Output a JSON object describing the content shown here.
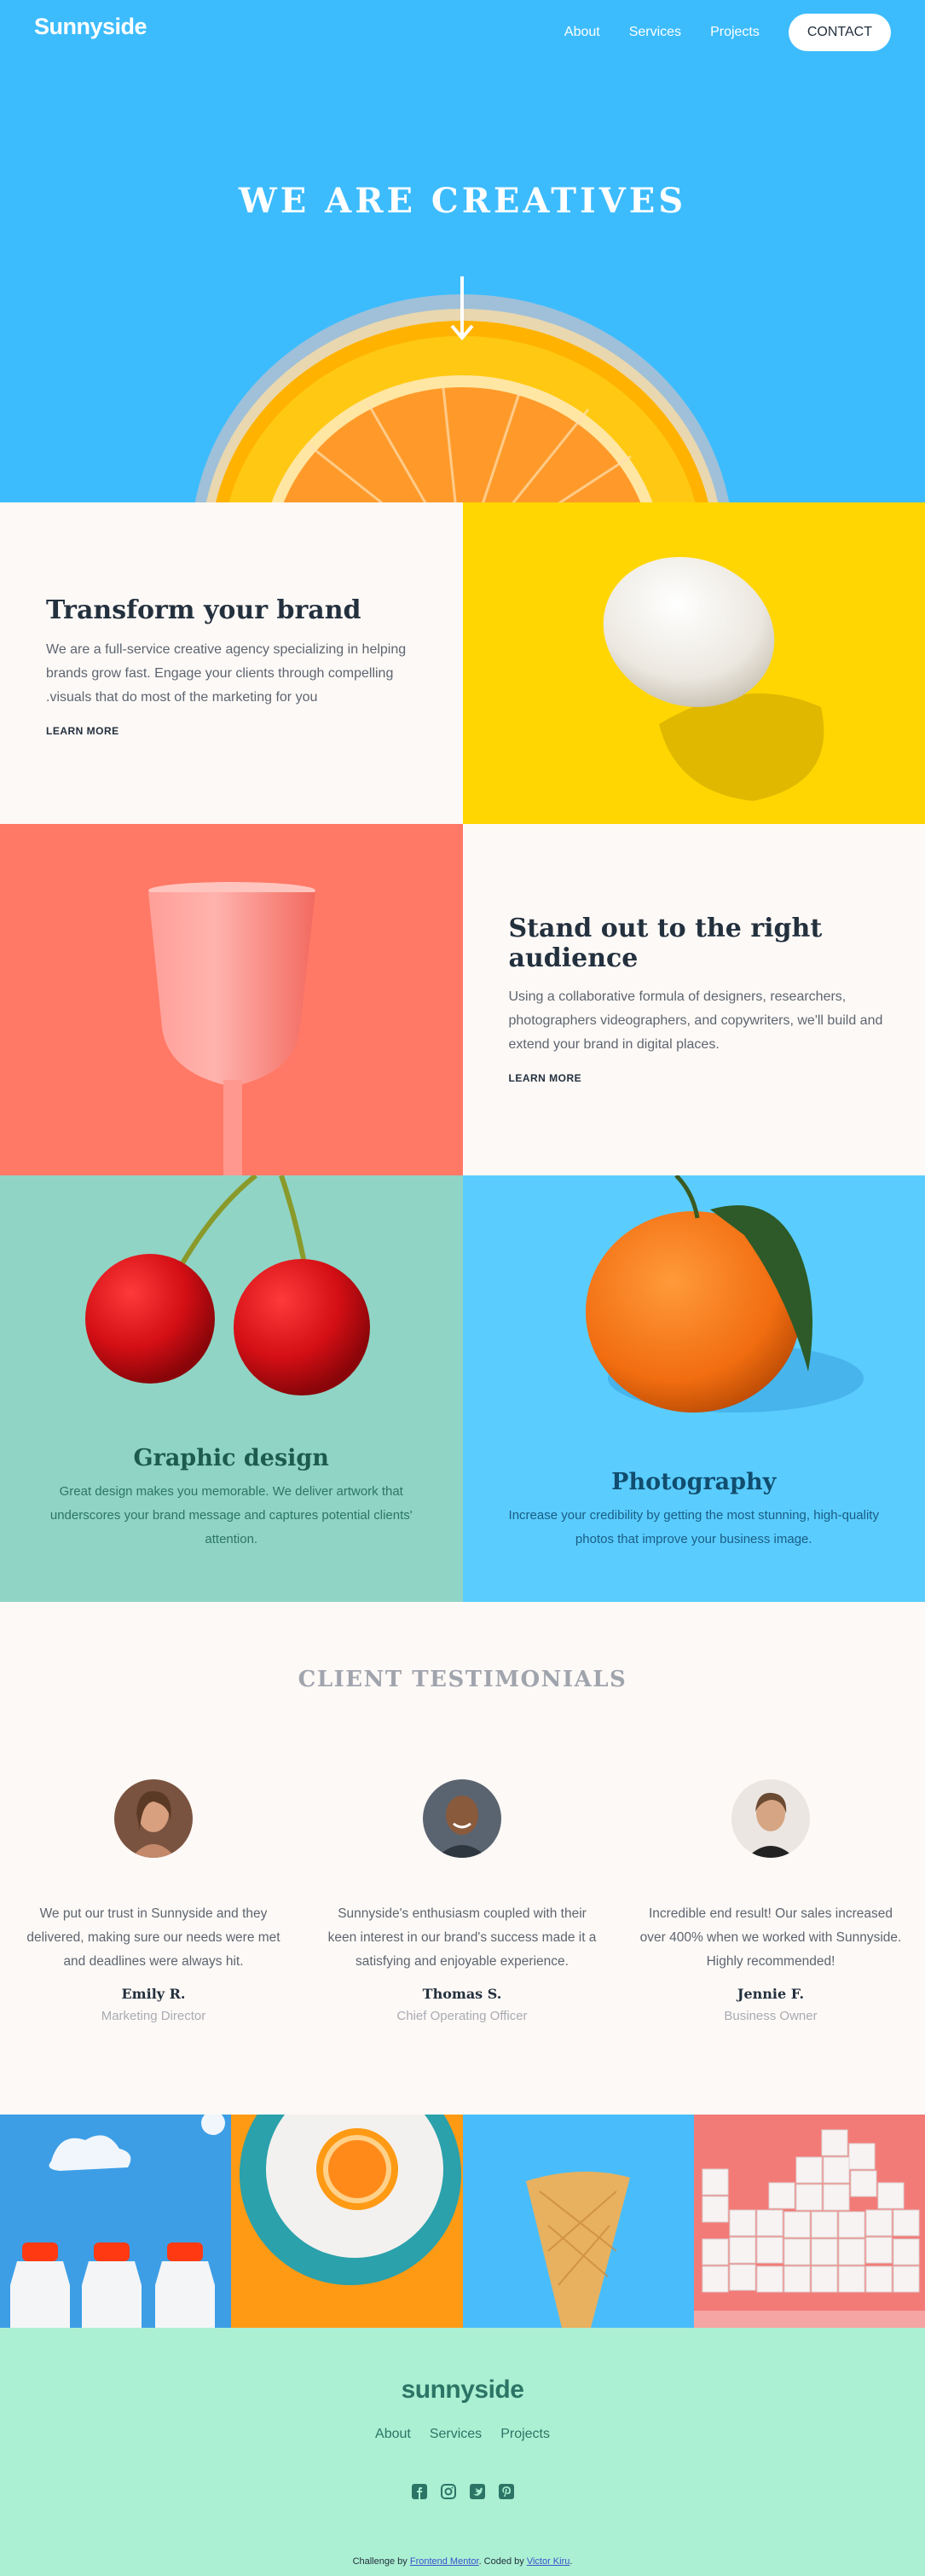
{
  "header": {
    "logo": "Sunnyside",
    "nav": [
      "About",
      "Services",
      "Projects"
    ],
    "contact": "CONTACT"
  },
  "hero": {
    "title": "WE ARE CREATIVES",
    "arrow_icon": "arrow-down-icon"
  },
  "transform": {
    "title": "Transform your brand",
    "body": "We are a full-service creative agency specializing in helping brands grow fast. Engage your clients through compelling .visuals that do most of the marketing for you",
    "link": "LEARN MORE"
  },
  "standout": {
    "title": "Stand out to the right audience",
    "body": "Using a collaborative formula of designers, researchers, photographers videographers, and copywriters, we'll build and extend your brand in digital places.",
    "link": "LEARN MORE"
  },
  "graphic": {
    "title": "Graphic design",
    "body": "Great design makes you memorable. We deliver artwork that underscores your brand message and captures potential clients' attention."
  },
  "photo": {
    "title": "Photography",
    "body": "Increase your credibility by getting the most stunning, high-quality photos that improve your business image."
  },
  "testimonials": {
    "heading": "CLIENT TESTIMONIALS",
    "items": [
      {
        "quote": "We put our trust in Sunnyside and they delivered, making sure our needs were met and deadlines were always hit.",
        "name": "Emily R.",
        "role": "Marketing Director"
      },
      {
        "quote": "Sunnyside's enthusiasm coupled with their keen interest in our brand's success made it a satisfying and enjoyable experience.",
        "name": "Thomas S.",
        "role": "Chief Operating Officer"
      },
      {
        "quote": "Incredible end result! Our sales increased over 400% when we worked with Sunnyside. Highly recommended!",
        "name": "Jennie F.",
        "role": "Business Owner"
      }
    ]
  },
  "footer": {
    "logo": "sunnyside",
    "nav": [
      "About",
      "Services",
      "Projects"
    ],
    "social_icons": [
      "facebook-icon",
      "instagram-icon",
      "twitter-icon",
      "pinterest-icon"
    ],
    "attrib_prefix": "Challenge by ",
    "attrib_fm": "Frontend Mentor",
    "attrib_mid": ". Coded by ",
    "attrib_author": "Victor Kiru",
    "attrib_suffix": "."
  },
  "colors": {
    "hero_blue": "#3dbcfd",
    "yellow": "#ffd601",
    "coral": "#ff7966",
    "teal": "#90d4c5",
    "sky": "#5acdfe",
    "mint": "#abf0d3",
    "dark": "#23303e"
  }
}
